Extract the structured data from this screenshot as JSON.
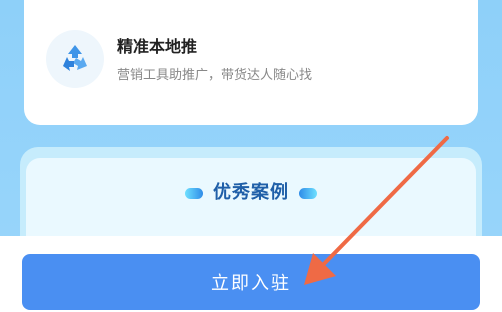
{
  "partial_item": {
    "icon": "feature-icon",
    "desc": "· · · · · · · · · · ·"
  },
  "feature": {
    "icon": "recycle-arrows-icon",
    "title": "精准本地推",
    "desc": "营销工具助推广，带货达人随心找"
  },
  "section": {
    "title": "优秀案例"
  },
  "cta": {
    "label": "立即入驻"
  },
  "colors": {
    "background": "#8fd0f8",
    "button": "#4a8ff2",
    "section_title": "#1f5fa8",
    "annotation_arrow": "#ef6a45"
  }
}
